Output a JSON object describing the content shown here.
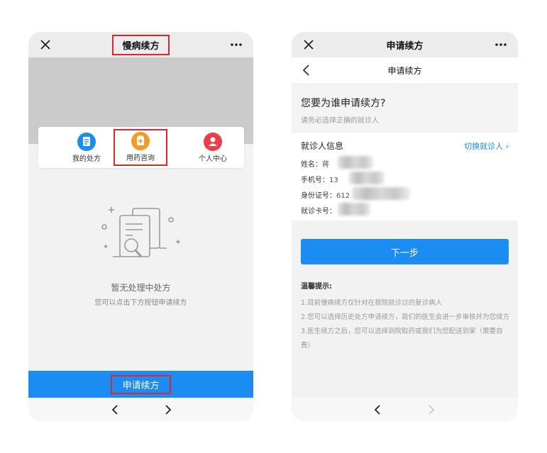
{
  "left_screen": {
    "title": "慢病续方",
    "menu": [
      {
        "label": "我的处方",
        "icon": "prescription-icon",
        "color": "#1a8cf2"
      },
      {
        "label": "用药咨询",
        "icon": "medicine-icon",
        "color": "#f59a23"
      },
      {
        "label": "个人中心",
        "icon": "person-icon",
        "color": "#e8404a"
      }
    ],
    "empty_title": "暂无处理中处方",
    "empty_subtitle": "您可以点击下方按钮申请续方",
    "apply_label": "申请续方"
  },
  "right_screen": {
    "title": "申请续方",
    "page_title": "申请续方",
    "question": "您要为谁申请续方?",
    "question_hint": "请务必选择正确的就诊人",
    "patient_header": "就诊人信息",
    "switch_label": "切换就诊人 ›",
    "fields": {
      "name": "姓名：",
      "name_val": "蒋",
      "phone": "手机号：",
      "phone_val": "13",
      "id": "身份证号：",
      "id_val": "612",
      "card": "就诊卡号："
    },
    "next_label": "下一步",
    "tips_title": "温馨提示:",
    "tips": [
      "1.目前慢病续方仅针对在我院就诊过的复诊病人",
      "2.您可以选择历史处方申请续方，我们的医生会进一步审核并为您续方",
      "3.医生续方之后，您可以选择到院取药或我们为您配送到家（需要自费）"
    ]
  },
  "colors": {
    "accent": "#1a8cf2",
    "highlight": "#e0262b"
  }
}
